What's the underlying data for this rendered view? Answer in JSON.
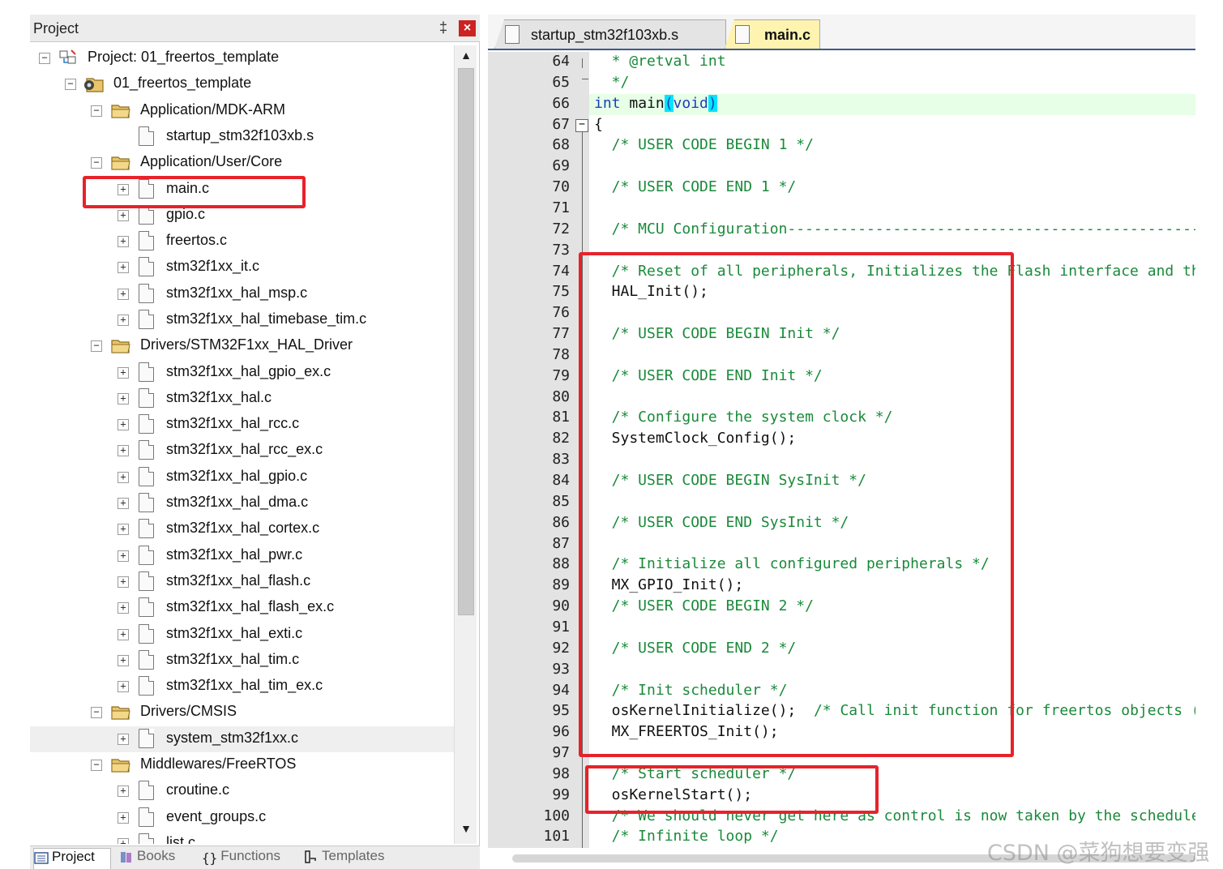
{
  "project_panel": {
    "title": "Project",
    "pin_glyph": "‡",
    "close_glyph": "×",
    "tree": [
      {
        "label": "Project: 01_freertos_template",
        "level": 0,
        "kind": "project",
        "toggle": "−"
      },
      {
        "label": "01_freertos_template",
        "level": 1,
        "kind": "target",
        "toggle": "−"
      },
      {
        "label": "Application/MDK-ARM",
        "level": 2,
        "kind": "folder",
        "toggle": "−"
      },
      {
        "label": "startup_stm32f103xb.s",
        "level": 3,
        "kind": "file",
        "toggle": ""
      },
      {
        "label": "Application/User/Core",
        "level": 2,
        "kind": "folder",
        "toggle": "−"
      },
      {
        "label": "main.c",
        "level": 3,
        "kind": "file",
        "toggle": "+"
      },
      {
        "label": "gpio.c",
        "level": 3,
        "kind": "file",
        "toggle": "+"
      },
      {
        "label": "freertos.c",
        "level": 3,
        "kind": "file",
        "toggle": "+"
      },
      {
        "label": "stm32f1xx_it.c",
        "level": 3,
        "kind": "file",
        "toggle": "+"
      },
      {
        "label": "stm32f1xx_hal_msp.c",
        "level": 3,
        "kind": "file",
        "toggle": "+"
      },
      {
        "label": "stm32f1xx_hal_timebase_tim.c",
        "level": 3,
        "kind": "file",
        "toggle": "+"
      },
      {
        "label": "Drivers/STM32F1xx_HAL_Driver",
        "level": 2,
        "kind": "folder",
        "toggle": "−"
      },
      {
        "label": "stm32f1xx_hal_gpio_ex.c",
        "level": 3,
        "kind": "file",
        "toggle": "+"
      },
      {
        "label": "stm32f1xx_hal.c",
        "level": 3,
        "kind": "file",
        "toggle": "+"
      },
      {
        "label": "stm32f1xx_hal_rcc.c",
        "level": 3,
        "kind": "file",
        "toggle": "+"
      },
      {
        "label": "stm32f1xx_hal_rcc_ex.c",
        "level": 3,
        "kind": "file",
        "toggle": "+"
      },
      {
        "label": "stm32f1xx_hal_gpio.c",
        "level": 3,
        "kind": "file",
        "toggle": "+"
      },
      {
        "label": "stm32f1xx_hal_dma.c",
        "level": 3,
        "kind": "file",
        "toggle": "+"
      },
      {
        "label": "stm32f1xx_hal_cortex.c",
        "level": 3,
        "kind": "file",
        "toggle": "+"
      },
      {
        "label": "stm32f1xx_hal_pwr.c",
        "level": 3,
        "kind": "file",
        "toggle": "+"
      },
      {
        "label": "stm32f1xx_hal_flash.c",
        "level": 3,
        "kind": "file",
        "toggle": "+"
      },
      {
        "label": "stm32f1xx_hal_flash_ex.c",
        "level": 3,
        "kind": "file",
        "toggle": "+"
      },
      {
        "label": "stm32f1xx_hal_exti.c",
        "level": 3,
        "kind": "file",
        "toggle": "+"
      },
      {
        "label": "stm32f1xx_hal_tim.c",
        "level": 3,
        "kind": "file",
        "toggle": "+"
      },
      {
        "label": "stm32f1xx_hal_tim_ex.c",
        "level": 3,
        "kind": "file",
        "toggle": "+"
      },
      {
        "label": "Drivers/CMSIS",
        "level": 2,
        "kind": "folder",
        "toggle": "−"
      },
      {
        "label": "system_stm32f1xx.c",
        "level": 3,
        "kind": "file",
        "toggle": "+",
        "selected": true
      },
      {
        "label": "Middlewares/FreeRTOS",
        "level": 2,
        "kind": "folder",
        "toggle": "−"
      },
      {
        "label": "croutine.c",
        "level": 3,
        "kind": "file",
        "toggle": "+"
      },
      {
        "label": "event_groups.c",
        "level": 3,
        "kind": "file",
        "toggle": "+"
      },
      {
        "label": "list.c",
        "level": 3,
        "kind": "file",
        "toggle": "+"
      }
    ],
    "bottom_tabs": [
      {
        "label": "Project",
        "icon": "project-icon",
        "active": true
      },
      {
        "label": "Books",
        "icon": "books-icon",
        "active": false
      },
      {
        "label": "Functions",
        "icon": "functions-icon",
        "active": false
      },
      {
        "label": "Templates",
        "icon": "templates-icon",
        "active": false
      }
    ]
  },
  "editor": {
    "tabs": [
      {
        "label": "startup_stm32f103xb.s",
        "active": false
      },
      {
        "label": "main.c",
        "active": true
      }
    ],
    "current_line": 66,
    "lines": [
      {
        "n": "64",
        "text": "  * @retval int",
        "style": "comment"
      },
      {
        "n": "65",
        "text": "  */",
        "style": "comment"
      },
      {
        "n": "66",
        "text": "",
        "style": "main-decl"
      },
      {
        "n": "67",
        "text": "{",
        "style": "plain",
        "fold": true
      },
      {
        "n": "68",
        "text": "  /* USER CODE BEGIN 1 */",
        "style": "comment"
      },
      {
        "n": "69",
        "text": "",
        "style": "plain"
      },
      {
        "n": "70",
        "text": "  /* USER CODE END 1 */",
        "style": "comment"
      },
      {
        "n": "71",
        "text": "",
        "style": "plain"
      },
      {
        "n": "72",
        "text": "  /* MCU Configuration--------------------------------------------------------",
        "style": "comment"
      },
      {
        "n": "73",
        "text": "",
        "style": "plain"
      },
      {
        "n": "74",
        "text": "  /* Reset of all peripherals, Initializes the Flash interface and the Systick. */",
        "style": "comment"
      },
      {
        "n": "75",
        "text": "  HAL_Init();",
        "style": "plain"
      },
      {
        "n": "76",
        "text": "",
        "style": "plain"
      },
      {
        "n": "77",
        "text": "  /* USER CODE BEGIN Init */",
        "style": "comment"
      },
      {
        "n": "78",
        "text": "",
        "style": "plain"
      },
      {
        "n": "79",
        "text": "  /* USER CODE END Init */",
        "style": "comment"
      },
      {
        "n": "80",
        "text": "",
        "style": "plain"
      },
      {
        "n": "81",
        "text": "  /* Configure the system clock */",
        "style": "comment"
      },
      {
        "n": "82",
        "text": "  SystemClock_Config();",
        "style": "plain"
      },
      {
        "n": "83",
        "text": "",
        "style": "plain"
      },
      {
        "n": "84",
        "text": "  /* USER CODE BEGIN SysInit */",
        "style": "comment"
      },
      {
        "n": "85",
        "text": "",
        "style": "plain"
      },
      {
        "n": "86",
        "text": "  /* USER CODE END SysInit */",
        "style": "comment"
      },
      {
        "n": "87",
        "text": "",
        "style": "plain"
      },
      {
        "n": "88",
        "text": "  /* Initialize all configured peripherals */",
        "style": "comment"
      },
      {
        "n": "89",
        "text": "  MX_GPIO_Init();",
        "style": "plain"
      },
      {
        "n": "90",
        "text": "  /* USER CODE BEGIN 2 */",
        "style": "comment"
      },
      {
        "n": "91",
        "text": "",
        "style": "plain"
      },
      {
        "n": "92",
        "text": "  /* USER CODE END 2 */",
        "style": "comment"
      },
      {
        "n": "93",
        "text": "",
        "style": "plain"
      },
      {
        "n": "94",
        "text": "  /* Init scheduler */",
        "style": "comment"
      },
      {
        "n": "95",
        "text": "  osKernelInitialize();  /* Call init function for freertos objects (in freertos.c) */",
        "style": "mixed",
        "code": "  osKernelInitialize();  ",
        "comment": "/* Call init function for freertos objects (in freertos.c) */"
      },
      {
        "n": "96",
        "text": "  MX_FREERTOS_Init();",
        "style": "plain"
      },
      {
        "n": "97",
        "text": "",
        "style": "plain"
      },
      {
        "n": "98",
        "text": "  /* Start scheduler */",
        "style": "comment"
      },
      {
        "n": "99",
        "text": "  osKernelStart();",
        "style": "plain"
      },
      {
        "n": "100",
        "text": "  /* We should never get here as control is now taken by the scheduler */",
        "style": "comment"
      },
      {
        "n": "101",
        "text": "  /* Infinite loop */",
        "style": "comment"
      }
    ],
    "main_decl": {
      "kw_int": "int",
      "name": " main",
      "paren_open": "(",
      "kw_void": "void",
      "paren_close": ")"
    }
  },
  "watermark": "CSDN @菜狗想要变强",
  "colors": {
    "annotation_red": "#e8222a",
    "comment_green": "#1a8a3a",
    "keyword_blue": "#1a3fb5",
    "brace_highlight": "#00e5ff",
    "current_line_bg": "#e6ffe6",
    "active_tab_bg": "#fff3b0"
  }
}
